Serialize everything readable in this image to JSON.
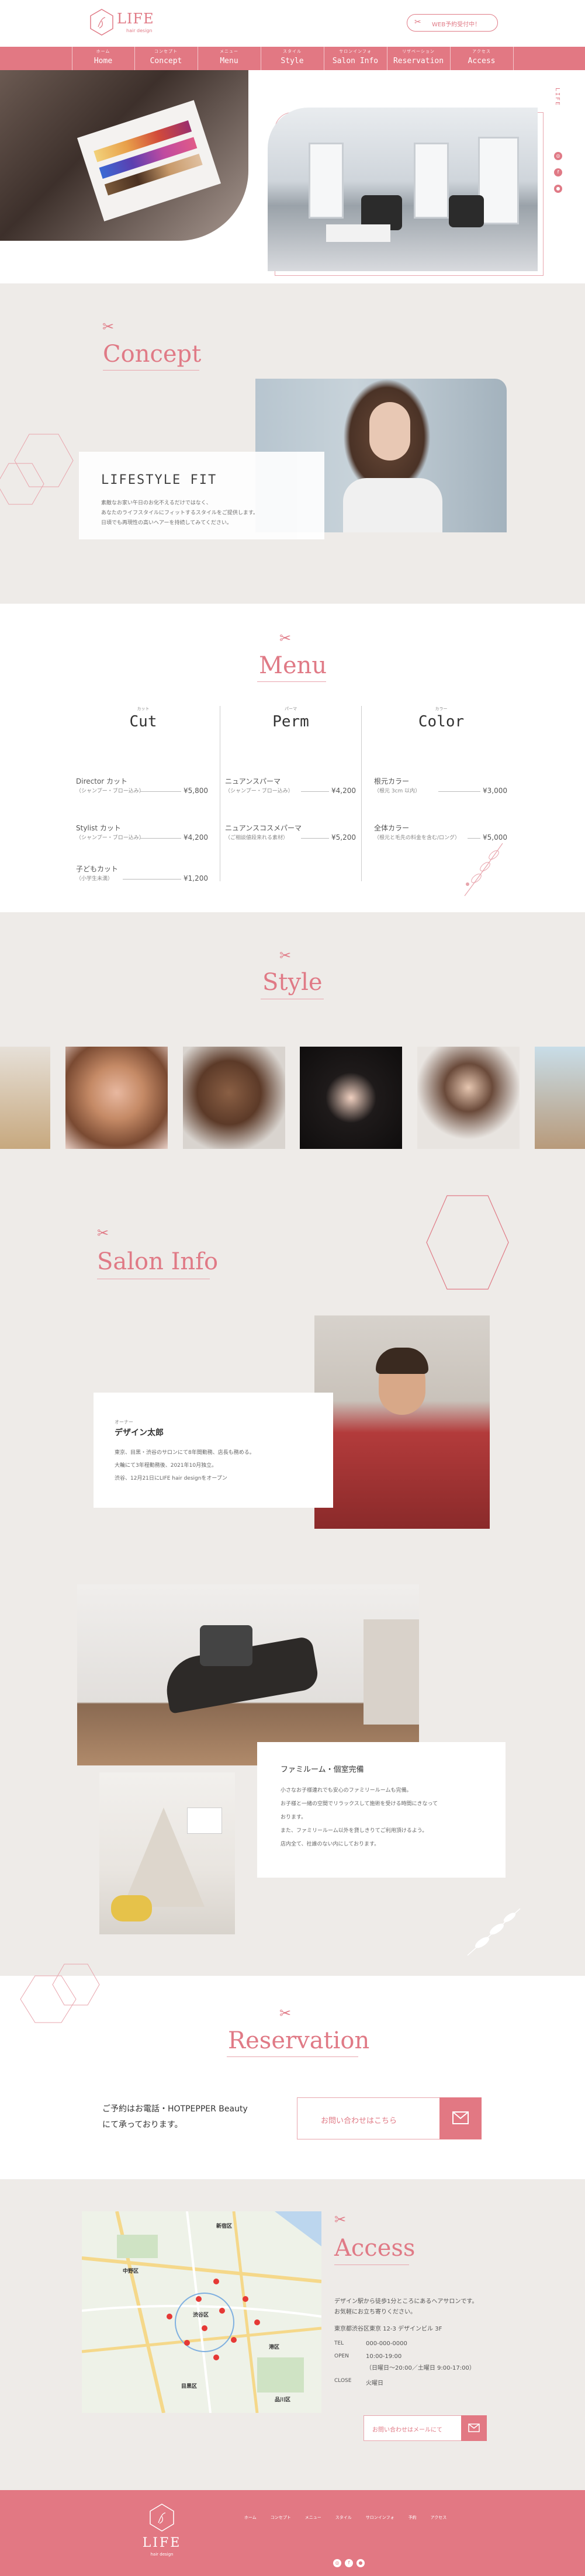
{
  "header": {
    "logo": "LIFE",
    "logo_sub": "hair design",
    "cta": "WEB予約受付中！"
  },
  "nav": [
    {
      "sub": "ホーム",
      "label": "Home"
    },
    {
      "sub": "コンセプト",
      "label": "Concept"
    },
    {
      "sub": "メニュー",
      "label": "Menu"
    },
    {
      "sub": "スタイル",
      "label": "Style"
    },
    {
      "sub": "サロンインフォ",
      "label": "Salon Info"
    },
    {
      "sub": "リザベーション",
      "label": "Reservation"
    },
    {
      "sub": "アクセス",
      "label": "Access"
    }
  ],
  "hero": {
    "side_text": "LIFE"
  },
  "concept": {
    "title": "Concept",
    "heading": "LIFESTYLE FIT",
    "body": [
      "素敵なお家い午日のお化不えるだけではなく、",
      "あなたのライフスタイルにフィットするスタイルをご提供します。",
      "日頃でも再現性の高いヘアーを持続してみてください。"
    ]
  },
  "menu": {
    "title": "Menu",
    "columns": [
      {
        "ruby": "カット",
        "name": "Cut",
        "items": [
          {
            "name": "Director カット",
            "sub": "（シャンプー・ブロー込み）",
            "price": "¥5,800"
          },
          {
            "name": "Stylist カット",
            "sub": "（シャンプー・ブロー込み）",
            "price": "¥4,200"
          },
          {
            "name": "子どもカット",
            "sub": "（小学生未満）",
            "price": "¥1,200"
          }
        ]
      },
      {
        "ruby": "パーマ",
        "name": "Perm",
        "items": [
          {
            "name": "ニュアンスパーマ",
            "sub": "（シャンプー・ブロー込み）",
            "price": "¥4,200"
          },
          {
            "name": "ニュアンスコスメパーマ",
            "sub": "（ご相談値段来れる素材）",
            "price": "¥5,200"
          }
        ]
      },
      {
        "ruby": "カラー",
        "name": "Color",
        "items": [
          {
            "name": "根元カラー",
            "sub": "（根元 3cm 以内）",
            "price": "¥3,000"
          },
          {
            "name": "全体カラー",
            "sub": "（根元と毛先の料金を含む/ロング）",
            "price": "¥5,000"
          }
        ]
      }
    ]
  },
  "style": {
    "title": "Style"
  },
  "salon": {
    "title": "Salon Info",
    "owner_role": "オーナー",
    "owner_name": "デザイン太郎",
    "owner_body": [
      "東京、目黒・渋谷のサロンにて8年間勤務、店長も務める。",
      "大輪にて3年程勤務後、2021年10月独立。",
      "渋谷、12月21日にLIFE hair designをオープン"
    ],
    "family_title": "ファミルーム・個室完備",
    "family_body": [
      "小さなお子様連れでも安心のファミリールームも完備。",
      "お子様と一緒の空間でリラックスして施術を受ける時間にきなって",
      "おります。",
      "また、ファミリールーム以外を貸しきりてご利用頂けるよう。",
      "店内全て、社誰のない内にしております。"
    ]
  },
  "reservation": {
    "title": "Reservation",
    "text_line1": "ご予約はお電話・HOTPEPPER Beauty",
    "text_line2": "にて承っております。",
    "button": "お問い合わせはこちら"
  },
  "access": {
    "title": "Access",
    "desc_line1": "デザイン駅から徒歩1分ところにあるヘアサロンです。",
    "desc_line2": "お気軽にお立ち寄りください。",
    "address": "東京都渋谷区東京 12-3 デザインビル 3F",
    "tel_label": "TEL",
    "tel": "000-000-0000",
    "open_label": "OPEN",
    "open_1": "10:00-19:00",
    "open_2": "（日曜日～20:00／土曜日 9:00-17:00）",
    "close_label": "CLOSE",
    "close": "火曜日",
    "button": "お問い合わせはメールにて",
    "map_labels": [
      "新宿区",
      "渋谷区",
      "目黒区",
      "港区",
      "中野区",
      "品川区"
    ]
  },
  "footer": {
    "logo": "LIFE",
    "logo_sub": "hair design",
    "links": [
      "ホーム",
      "コンセプト",
      "メニュー",
      "スタイル",
      "サロンインフォ",
      "予約",
      "アクセス"
    ]
  },
  "colors": {
    "accent": "#e27883",
    "beige": "#eeebe8"
  }
}
